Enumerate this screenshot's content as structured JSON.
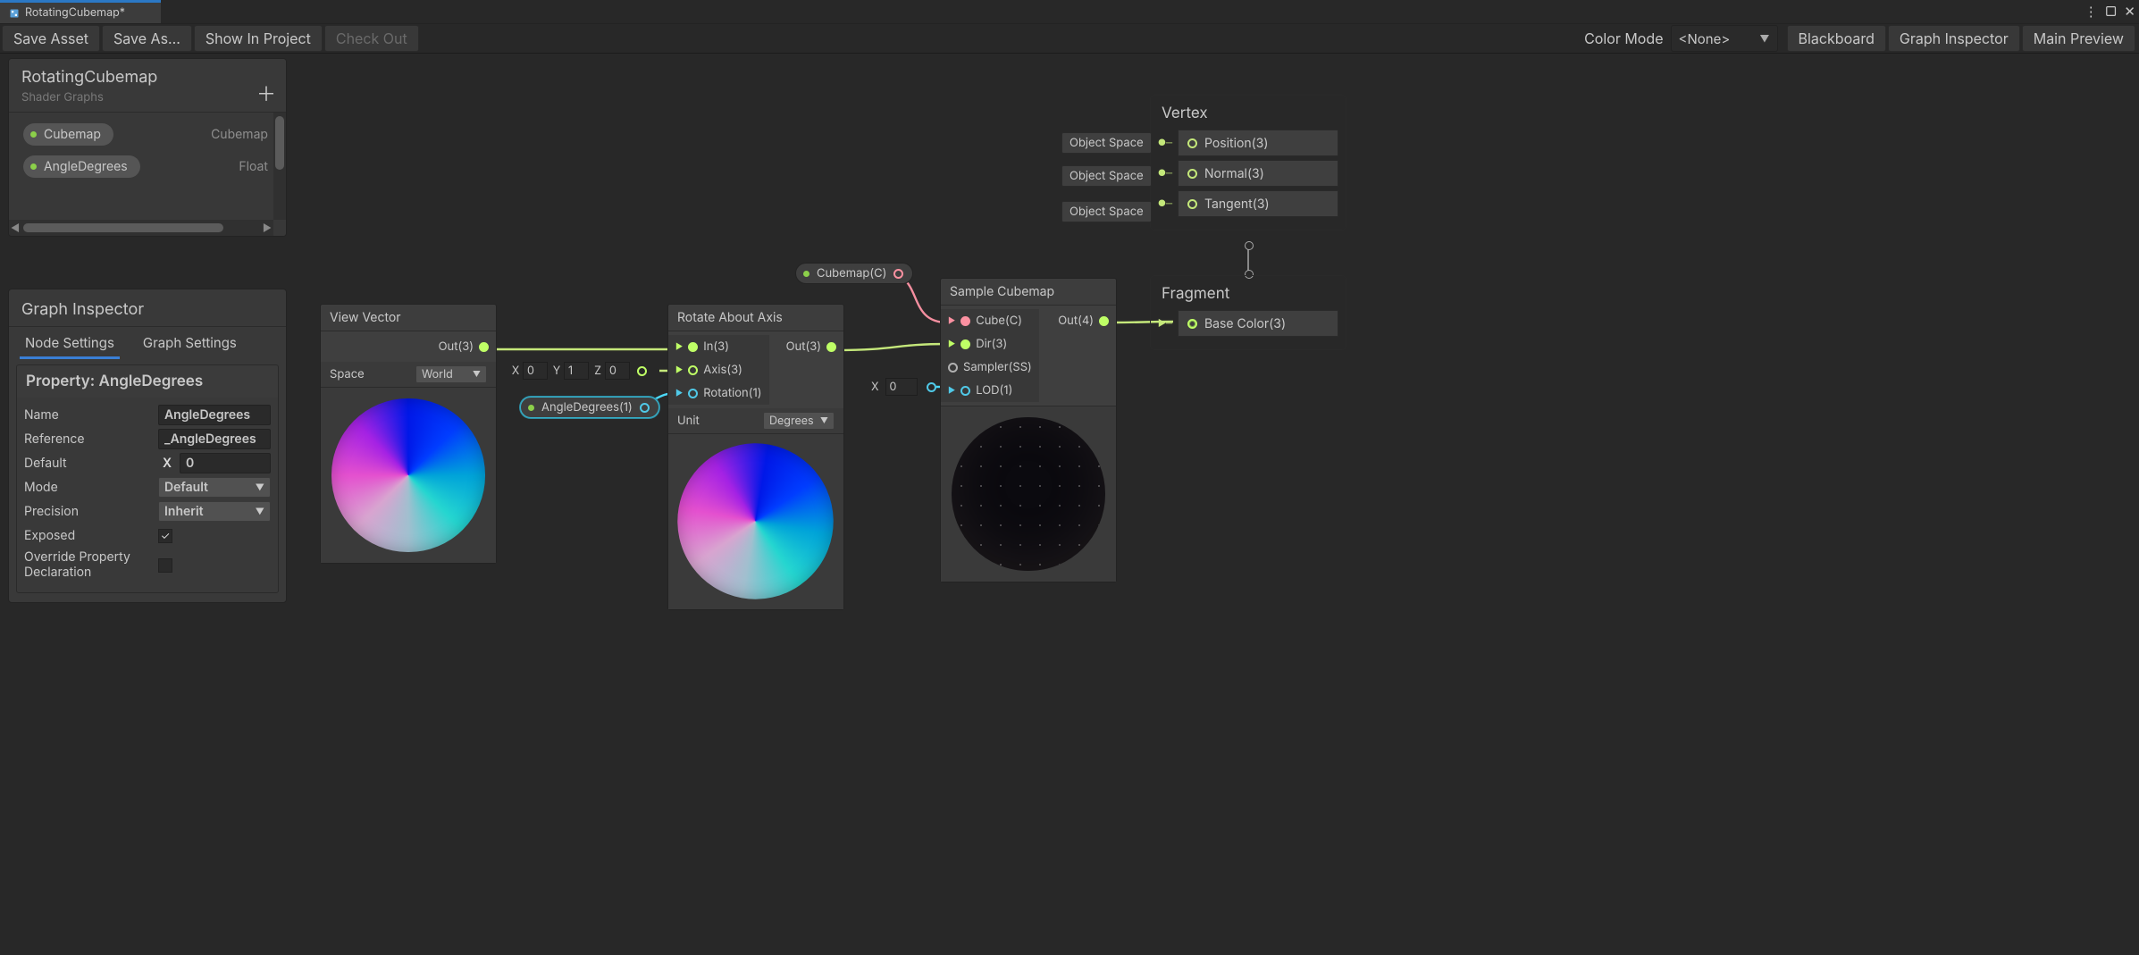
{
  "tab": {
    "title": "RotatingCubemap*"
  },
  "toolbar": {
    "save_asset": "Save Asset",
    "save_as": "Save As...",
    "show_in_project": "Show In Project",
    "check_out": "Check Out",
    "color_mode_label": "Color Mode",
    "color_mode_value": "<None>",
    "blackboard_btn": "Blackboard",
    "graph_inspector_btn": "Graph Inspector",
    "main_preview_btn": "Main Preview"
  },
  "blackboard": {
    "title": "RotatingCubemap",
    "subtitle": "Shader Graphs",
    "rows": [
      {
        "name": "Cubemap",
        "type": "Cubemap"
      },
      {
        "name": "AngleDegrees",
        "type": "Float"
      }
    ]
  },
  "inspector": {
    "title": "Graph Inspector",
    "tabs": {
      "node": "Node Settings",
      "graph": "Graph Settings"
    },
    "section_title": "Property: AngleDegrees",
    "fields": {
      "name_label": "Name",
      "name_value": "AngleDegrees",
      "reference_label": "Reference",
      "reference_value": "_AngleDegrees",
      "default_label": "Default",
      "default_prefix": "X",
      "default_value": "0",
      "mode_label": "Mode",
      "mode_value": "Default",
      "precision_label": "Precision",
      "precision_value": "Inherit",
      "exposed_label": "Exposed",
      "exposed_checked": true,
      "override_label": "Override Property Declaration",
      "override_checked": false
    }
  },
  "nodes": {
    "view_vector": {
      "title": "View Vector",
      "out_label": "Out(3)",
      "space_label": "Space",
      "space_value": "World"
    },
    "rotate_axis": {
      "title": "Rotate About Axis",
      "in_label": "In(3)",
      "axis_label": "Axis(3)",
      "rotation_label": "Rotation(1)",
      "out_label": "Out(3)",
      "unit_label": "Unit",
      "unit_value": "Degrees"
    },
    "sample_cubemap": {
      "title": "Sample Cubemap",
      "cube_label": "Cube(C)",
      "dir_label": "Dir(3)",
      "sampler_label": "Sampler(SS)",
      "lod_label": "LOD(1)",
      "out_label": "Out(4)"
    },
    "cubemap_prop": {
      "label": "Cubemap(C)"
    },
    "angle_prop": {
      "label": "AngleDegrees(1)"
    },
    "axis_vec": {
      "x_label": "X",
      "x": "0",
      "y_label": "Y",
      "y": "1",
      "z_label": "Z",
      "z": "0"
    },
    "lod_scalar": {
      "x_label": "X",
      "x": "0"
    }
  },
  "master": {
    "vertex": {
      "title": "Vertex",
      "space0": "Object Space",
      "slot0": "Position(3)",
      "space1": "Object Space",
      "slot1": "Normal(3)",
      "space2": "Object Space",
      "slot2": "Tangent(3)"
    },
    "fragment": {
      "title": "Fragment",
      "slot0": "Base Color(3)"
    }
  }
}
